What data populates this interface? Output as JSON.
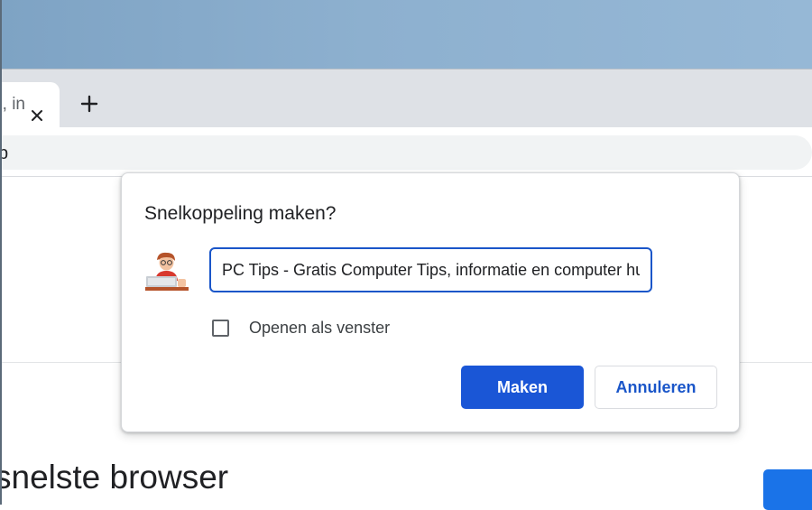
{
  "browser": {
    "tab": {
      "title": "PC Tips - Gratis Computer Tips, in",
      "close_icon": "close-icon"
    },
    "new_tab_icon": "plus-icon",
    "address_fragment": "p"
  },
  "dialog": {
    "title": "Snelkoppeling maken?",
    "app_icon": "pc-tips-avatar-icon",
    "name_value": "PC Tips - Gratis Computer Tips, informatie en computer hulp",
    "checkbox": {
      "label": "Openen als venster",
      "checked": false
    },
    "primary_button": "Maken",
    "secondary_button": "Annuleren"
  },
  "page": {
    "heading": "snelste browser"
  },
  "colors": {
    "accent": "#1a56d6",
    "tabstrip": "#dee1e6",
    "desktop": "#8db0cf"
  }
}
